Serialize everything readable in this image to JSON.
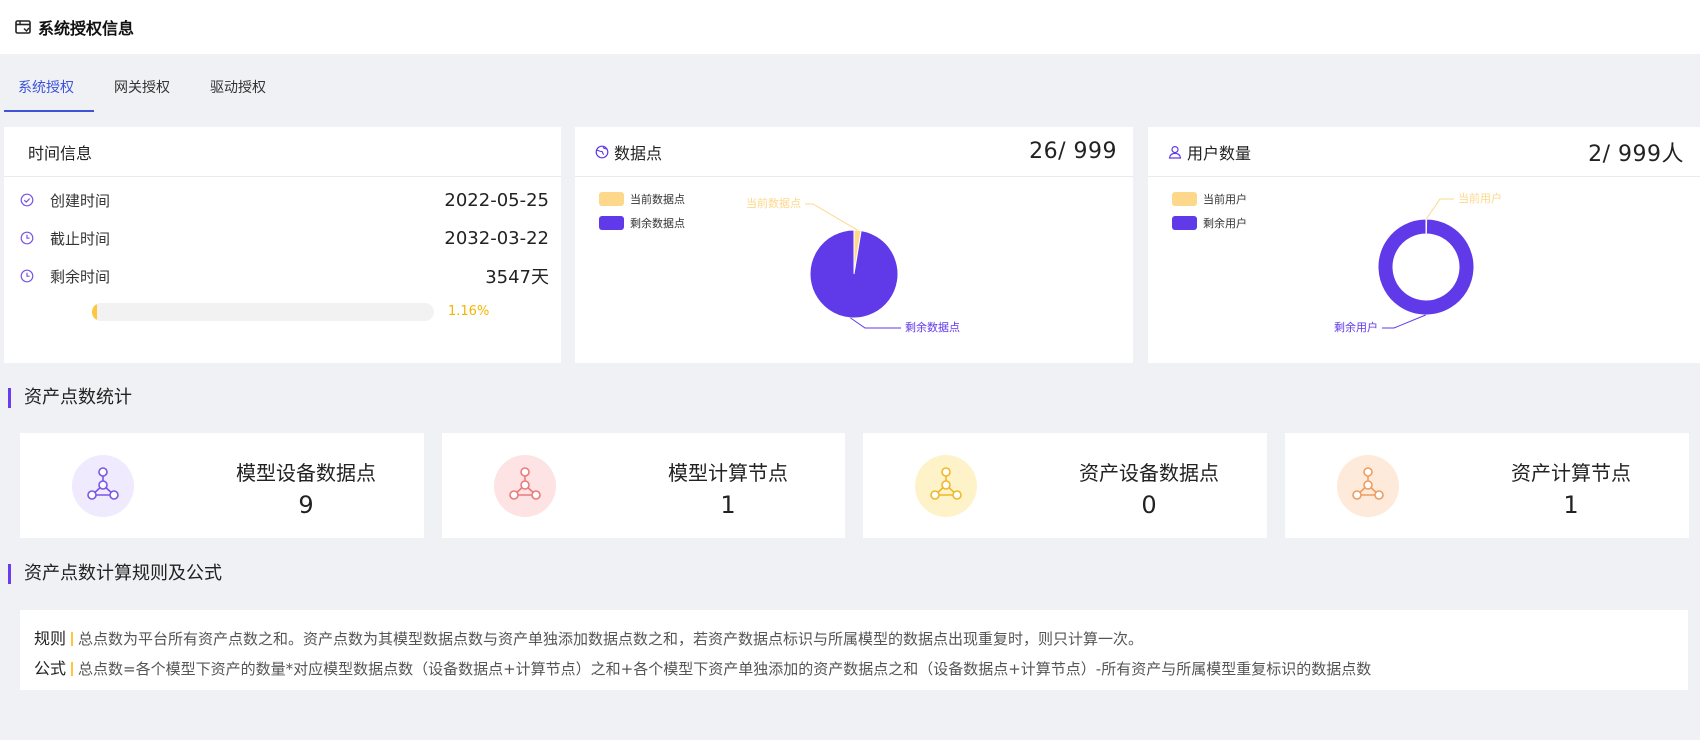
{
  "header": {
    "title": "系统授权信息",
    "icon": "window-icon"
  },
  "tabs": [
    {
      "label": "系统授权",
      "active": true
    },
    {
      "label": "网关授权",
      "active": false
    },
    {
      "label": "驱动授权",
      "active": false
    }
  ],
  "time_card": {
    "title": "时间信息",
    "rows": [
      {
        "label": "创建时间",
        "value": "2022-05-25",
        "icon": "check-circle-icon"
      },
      {
        "label": "截止时间",
        "value": "2032-03-22",
        "icon": "clock-icon"
      },
      {
        "label": "剩余时间",
        "value": "3547天",
        "icon": "clock-icon"
      }
    ],
    "progress": {
      "percent": 1.16,
      "label": "1.16%",
      "color": "#ffc53d"
    }
  },
  "datapoint_card": {
    "title": "数据点",
    "value": "26/ 999",
    "icon": "globe-icon",
    "legend": [
      {
        "label": "当前数据点",
        "color": "#fdd88a"
      },
      {
        "label": "剩余数据点",
        "color": "#6039e8"
      }
    ]
  },
  "user_card": {
    "title": "用户数量",
    "value": "2/ 999人",
    "icon": "user-icon",
    "legend": [
      {
        "label": "当前用户",
        "color": "#fdd88a"
      },
      {
        "label": "剩余用户",
        "color": "#6039e8"
      }
    ]
  },
  "chart_data": [
    {
      "type": "pie",
      "categories": [
        "当前数据点",
        "剩余数据点"
      ],
      "values": [
        26,
        973
      ],
      "colors": [
        "#fdd88a",
        "#6039e8"
      ],
      "legend": "top-left"
    },
    {
      "type": "pie",
      "variant": "donut",
      "categories": [
        "当前用户",
        "剩余用户"
      ],
      "values": [
        2,
        997
      ],
      "colors": [
        "#fdd88a",
        "#6039e8"
      ],
      "legend": "top-left"
    }
  ],
  "asset_section": {
    "title": "资产点数统计",
    "cards": [
      {
        "label": "模型设备数据点",
        "value": "9",
        "circle_color": "#efeafd",
        "icon_color": "#7b55e6",
        "icon": "network-nodes-icon"
      },
      {
        "label": "模型计算节点",
        "value": "1",
        "circle_color": "#fde3e3",
        "icon_color": "#ea7b7b",
        "icon": "network-nodes-icon"
      },
      {
        "label": "资产设备数据点",
        "value": "0",
        "circle_color": "#fef3c8",
        "icon_color": "#efb82a",
        "icon": "network-nodes-icon"
      },
      {
        "label": "资产计算节点",
        "value": "1",
        "circle_color": "#fdeadb",
        "icon_color": "#ef9c5e",
        "icon": "network-nodes-icon"
      }
    ]
  },
  "rules_section": {
    "title": "资产点数计算规则及公式",
    "rule_tag": "规则",
    "rule_text": "总点数为平台所有资产点数之和。资产点数为其模型数据点数与资产单独添加数据点数之和，若资产数据点标识与所属模型的数据点出现重复时，则只计算一次。",
    "formula_tag": "公式",
    "formula_text": "总点数=各个模型下资产的数量*对应模型数据点数（设备数据点+计算节点）之和+各个模型下资产单独添加的资产数据点之和（设备数据点+计算节点）-所有资产与所属模型重复标识的数据点数"
  }
}
